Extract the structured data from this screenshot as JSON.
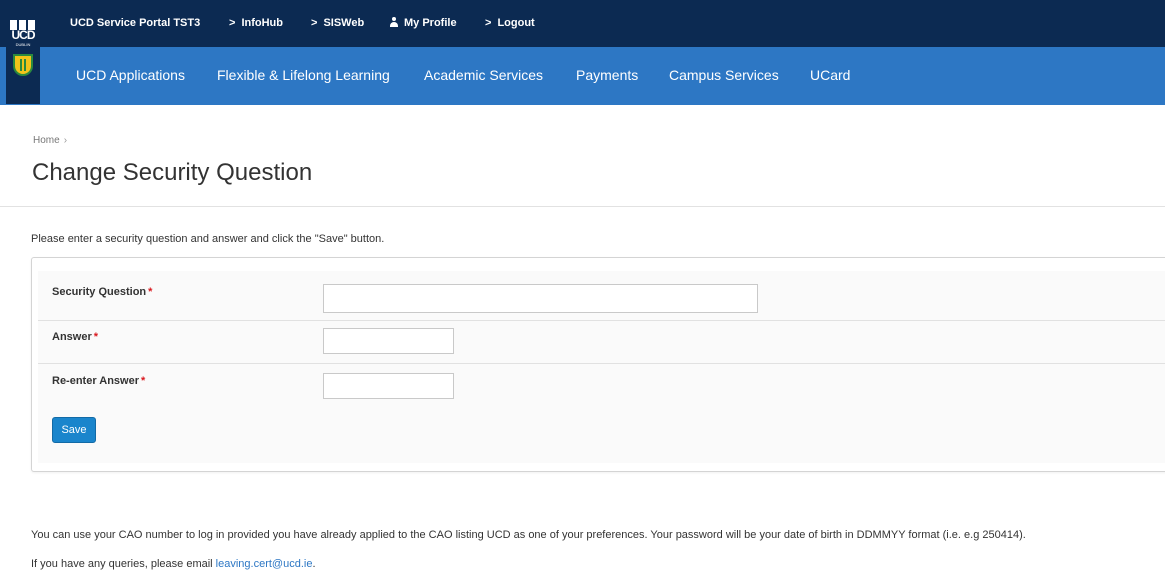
{
  "header": {
    "logo_text": "UCD",
    "logo_subtext": "DUBLIN",
    "top_links": [
      {
        "label": "UCD Service Portal TST3",
        "icon": ""
      },
      {
        "label": "InfoHub",
        "icon": "chevron-right-icon"
      },
      {
        "label": "SISWeb",
        "icon": "chevron-right-icon"
      },
      {
        "label": "My Profile",
        "icon": "user-icon"
      },
      {
        "label": "Logout",
        "icon": "chevron-right-icon"
      }
    ],
    "nav_items": [
      {
        "label": "UCD Applications"
      },
      {
        "label": "Flexible & Lifelong Learning"
      },
      {
        "label": "Academic Services"
      },
      {
        "label": "Payments"
      },
      {
        "label": "Campus Services"
      },
      {
        "label": "UCard"
      }
    ]
  },
  "breadcrumb": {
    "home": "Home",
    "separator": "›"
  },
  "page_title": "Change Security Question",
  "intro_text": "Please enter a security question and answer and click the \"Save\" button.",
  "form": {
    "required_marker": "*",
    "fields": [
      {
        "label": "Security Question",
        "value": ""
      },
      {
        "label": "Answer",
        "value": ""
      },
      {
        "label": "Re-enter Answer",
        "value": ""
      }
    ],
    "save_label": "Save"
  },
  "footer": {
    "cao_note": "You can use your CAO number to log in provided you have already applied to the CAO listing UCD as one of your preferences. Your password will be your date of birth in DDMMYY format (i.e. e.g 250414).",
    "query_prefix": "If you have any queries, please email ",
    "query_email": "leaving.cert@ucd.ie",
    "query_suffix": "."
  },
  "colors": {
    "topbar": "#0c2a52",
    "navbar": "#2d77c4",
    "button": "#1a85cc",
    "required": "#d9181e"
  }
}
